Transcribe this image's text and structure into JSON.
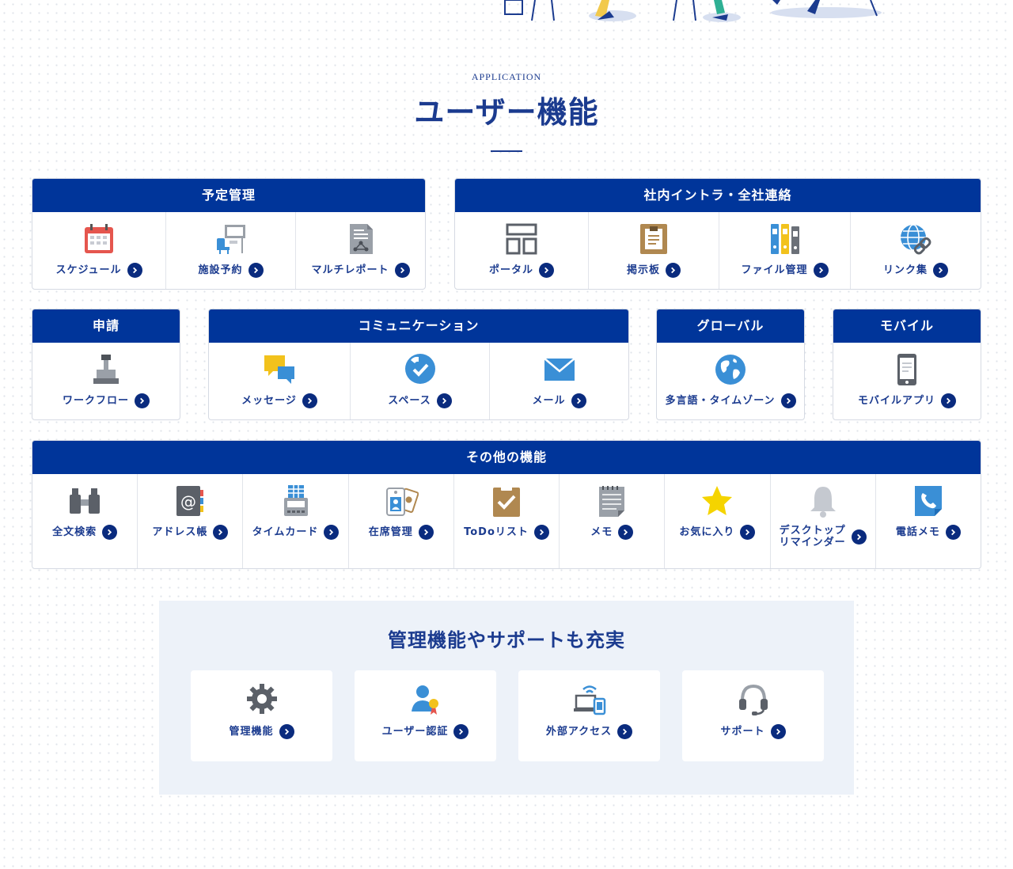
{
  "section": {
    "eyebrow": "APPLICATION",
    "heading": "ユーザー機能"
  },
  "groups": {
    "schedule": {
      "title": "予定管理",
      "items": [
        {
          "label": "スケジュール",
          "icon": "calendar-icon"
        },
        {
          "label": "施設予約",
          "icon": "facility-icon"
        },
        {
          "label": "マルチレポート",
          "icon": "report-icon"
        }
      ]
    },
    "intranet": {
      "title": "社内イントラ・全社連絡",
      "items": [
        {
          "label": "ポータル",
          "icon": "portal-icon"
        },
        {
          "label": "掲示板",
          "icon": "bulletin-board-icon"
        },
        {
          "label": "ファイル管理",
          "icon": "binders-icon"
        },
        {
          "label": "リンク集",
          "icon": "globe-link-icon"
        }
      ]
    },
    "request": {
      "title": "申請",
      "items": [
        {
          "label": "ワークフロー",
          "icon": "stamp-icon"
        }
      ]
    },
    "communication": {
      "title": "コミュニケーション",
      "items": [
        {
          "label": "メッセージ",
          "icon": "chat-bubbles-icon"
        },
        {
          "label": "スペース",
          "icon": "space-check-icon"
        },
        {
          "label": "メール",
          "icon": "mail-icon"
        }
      ]
    },
    "global": {
      "title": "グローバル",
      "items": [
        {
          "label": "多言語・タイムゾーン",
          "icon": "earth-icon"
        }
      ]
    },
    "mobile": {
      "title": "モバイル",
      "items": [
        {
          "label": "モバイルアプリ",
          "icon": "smartphone-icon"
        }
      ]
    },
    "other": {
      "title": "その他の機能",
      "items": [
        {
          "label": "全文検索",
          "icon": "binoculars-icon"
        },
        {
          "label": "アドレス帳",
          "icon": "address-book-icon"
        },
        {
          "label": "タイムカード",
          "icon": "timecard-icon"
        },
        {
          "label": "在席管理",
          "icon": "presence-icon"
        },
        {
          "label": "ToDoリスト",
          "icon": "todo-clipboard-icon"
        },
        {
          "label": "メモ",
          "icon": "memo-icon"
        },
        {
          "label": "お気に入り",
          "icon": "star-icon"
        },
        {
          "label": "デスクトップ\nリマインダー",
          "icon": "bell-icon"
        },
        {
          "label": "電話メモ",
          "icon": "phone-memo-icon"
        }
      ]
    }
  },
  "admin": {
    "title": "管理機能やサポートも充実",
    "items": [
      {
        "label": "管理機能",
        "icon": "gear-icon"
      },
      {
        "label": "ユーザー認証",
        "icon": "user-auth-icon"
      },
      {
        "label": "外部アクセス",
        "icon": "external-access-icon"
      },
      {
        "label": "サポート",
        "icon": "headset-icon"
      }
    ]
  },
  "colors": {
    "primary": "#00359a",
    "text": "#1b3b8f",
    "admin_bg": "#edf2f9"
  }
}
